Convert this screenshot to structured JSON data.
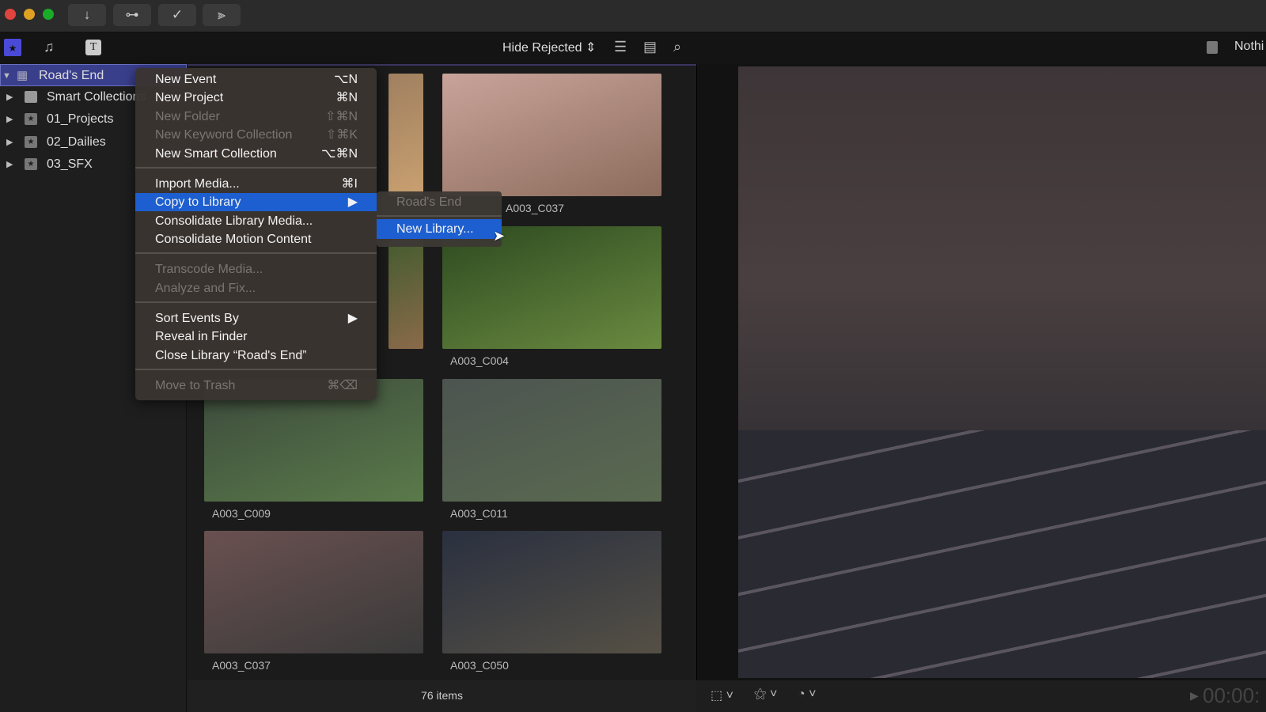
{
  "titlebar": {
    "buttons": [
      {
        "icon": "download-icon",
        "glyph": "↓"
      },
      {
        "icon": "key-icon",
        "glyph": "⊶"
      },
      {
        "icon": "checkmark-circle-icon",
        "glyph": "✓"
      },
      {
        "icon": "audio-waveform-icon",
        "glyph": "⫸"
      }
    ]
  },
  "toolbar": {
    "filter": "Hide Rejected",
    "filter_arrows": "⇕",
    "viewer_label": "Nothi"
  },
  "sidebar": {
    "library": "Road's End",
    "items": [
      {
        "label": "Smart Collections",
        "icon": "folder-icon"
      },
      {
        "label": "01_Projects",
        "icon": "event-star-icon"
      },
      {
        "label": "02_Dailies",
        "icon": "event-star-icon"
      },
      {
        "label": "03_SFX",
        "icon": "event-star-icon"
      }
    ]
  },
  "browser": {
    "clips": [
      {
        "label": "",
        "colors": [
          "#a08060",
          "#c9a070"
        ]
      },
      {
        "label": "A003_C037",
        "colors": [
          "#c9a39a",
          "#8c6c5c"
        ]
      },
      {
        "label": "",
        "colors": [
          "#3d5a2c",
          "#8a6a4a"
        ]
      },
      {
        "label": "A003_C004",
        "colors": [
          "#2d4a20",
          "#6a8a40"
        ]
      },
      {
        "label": "A003_C009",
        "colors": [
          "#3c4a3c",
          "#5a7a4a"
        ]
      },
      {
        "label": "A003_C011",
        "colors": [
          "#4c5450",
          "#5a6a50"
        ]
      },
      {
        "label": "A003_C037",
        "colors": [
          "#6a5050",
          "#3a3a3a"
        ]
      },
      {
        "label": "A003_C050",
        "colors": [
          "#2a3040",
          "#555045"
        ]
      }
    ],
    "status": "76 items"
  },
  "viewer": {
    "timecode": "00:00:"
  },
  "context_menu": {
    "items": [
      {
        "label": "New Event",
        "shortcut": "⌥N",
        "disabled": false
      },
      {
        "label": "New Project",
        "shortcut": "⌘N",
        "disabled": false
      },
      {
        "label": "New Folder",
        "shortcut": "⇧⌘N",
        "disabled": true
      },
      {
        "label": "New Keyword Collection",
        "shortcut": "⇧⌘K",
        "disabled": true
      },
      {
        "label": "New Smart Collection",
        "shortcut": "⌥⌘N",
        "disabled": false
      },
      {
        "label": "Import Media...",
        "shortcut": "⌘I",
        "disabled": false
      },
      {
        "label": "Copy to Library",
        "shortcut": "▶",
        "disabled": false,
        "selected": true
      },
      {
        "label": "Consolidate Library Media...",
        "shortcut": "",
        "disabled": false
      },
      {
        "label": "Consolidate Motion Content",
        "shortcut": "",
        "disabled": false
      },
      {
        "label": "Transcode Media...",
        "shortcut": "",
        "disabled": true
      },
      {
        "label": "Analyze and Fix...",
        "shortcut": "",
        "disabled": true
      },
      {
        "label": "Sort Events By",
        "shortcut": "▶",
        "disabled": false
      },
      {
        "label": "Reveal in Finder",
        "shortcut": "",
        "disabled": false
      },
      {
        "label": "Close Library “Road's End”",
        "shortcut": "",
        "disabled": false
      },
      {
        "label": "Move to Trash",
        "shortcut": "⌘⌫",
        "disabled": true
      }
    ]
  },
  "submenu": {
    "items": [
      {
        "label": "Road's End",
        "disabled": true
      },
      {
        "label": "New Library...",
        "selected": true
      }
    ]
  },
  "colors": {
    "accent": "#1d5fd0",
    "sidebar_selection": "#3a3f8c"
  }
}
